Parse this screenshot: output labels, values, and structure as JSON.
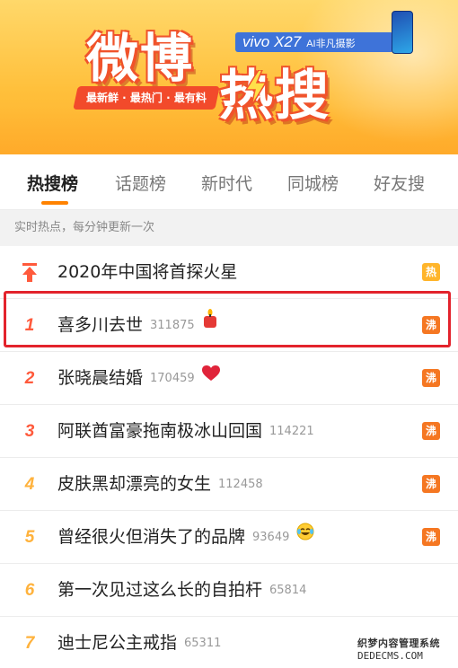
{
  "banner": {
    "title_1": "微博",
    "title_2": "热搜",
    "slogan": "最新鲜 · 最热门 · 最有料",
    "sponsor_brand": "vivo X27",
    "sponsor_tagline": "AI非凡摄影"
  },
  "tabs": [
    {
      "label": "热搜榜",
      "active": true
    },
    {
      "label": "话题榜",
      "active": false
    },
    {
      "label": "新时代",
      "active": false
    },
    {
      "label": "同城榜",
      "active": false
    },
    {
      "label": "好友搜",
      "active": false
    }
  ],
  "subtitle": "实时热点，每分钟更新一次",
  "pinned": {
    "topic": "2020年中国将首探火星",
    "badge": "热"
  },
  "items": [
    {
      "rank": "1",
      "topic": "喜多川去世",
      "count": "311875",
      "emoji": "candle-emoji",
      "badge": "沸"
    },
    {
      "rank": "2",
      "topic": "张晓晨结婚",
      "count": "170459",
      "emoji": "heart-emoji",
      "badge": "沸"
    },
    {
      "rank": "3",
      "topic": "阿联酋富豪拖南极冰山回国",
      "count": "114221",
      "emoji": "",
      "badge": "沸"
    },
    {
      "rank": "4",
      "topic": "皮肤黑却漂亮的女生",
      "count": "112458",
      "emoji": "",
      "badge": "沸"
    },
    {
      "rank": "5",
      "topic": "曾经很火但消失了的品牌",
      "count": "93649",
      "emoji": "laugh-cry-emoji",
      "badge": "沸"
    },
    {
      "rank": "6",
      "topic": "第一次见过这么长的自拍杆",
      "count": "65814",
      "emoji": "",
      "badge": ""
    },
    {
      "rank": "7",
      "topic": "迪士尼公主戒指",
      "count": "65311",
      "emoji": "",
      "badge": ""
    }
  ],
  "watermark": {
    "line1": "织梦内容管理系统",
    "line2": "DEDECMS.COM"
  },
  "colors": {
    "accent": "#ff8200",
    "highlight": "#e3232c",
    "hot": "#ffb52b",
    "boil": "#f57722"
  }
}
